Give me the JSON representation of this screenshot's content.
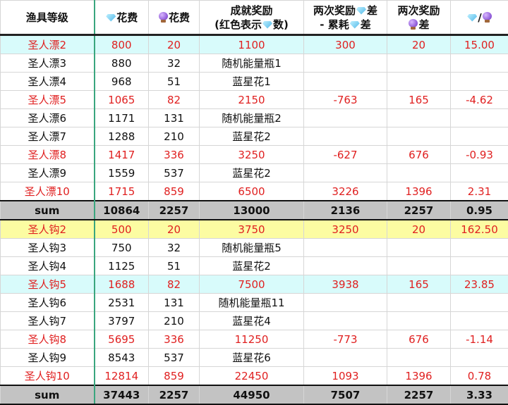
{
  "header": {
    "level": "渔具等级",
    "diamond_cost": "花费",
    "orb_cost": "花费",
    "reward_line1": "成就奖励",
    "reward_line2a": "(红色表示",
    "reward_line2b": "数)",
    "diff_line1a": "两次奖励",
    "diff_line1b": "差",
    "diff_line2a": "- 累耗",
    "diff_line2b": "差",
    "orbdiff_line1": "两次奖励",
    "orbdiff_line2": "差",
    "ratio_sep": "/"
  },
  "rows": [
    {
      "style": "red cyan",
      "c": [
        "圣人漂2",
        "800",
        "20",
        "1100",
        "300",
        "20",
        "15.00"
      ]
    },
    {
      "style": "",
      "c": [
        "圣人漂3",
        "880",
        "32",
        "随机能量瓶1",
        "",
        "",
        ""
      ]
    },
    {
      "style": "",
      "c": [
        "圣人漂4",
        "968",
        "51",
        "蓝星花1",
        "",
        "",
        ""
      ]
    },
    {
      "style": "red",
      "c": [
        "圣人漂5",
        "1065",
        "82",
        "2150",
        "-763",
        "165",
        "-4.62"
      ]
    },
    {
      "style": "",
      "c": [
        "圣人漂6",
        "1171",
        "131",
        "随机能量瓶2",
        "",
        "",
        ""
      ]
    },
    {
      "style": "",
      "c": [
        "圣人漂7",
        "1288",
        "210",
        "蓝星花2",
        "",
        "",
        ""
      ]
    },
    {
      "style": "red",
      "c": [
        "圣人漂8",
        "1417",
        "336",
        "3250",
        "-627",
        "676",
        "-0.93"
      ]
    },
    {
      "style": "",
      "c": [
        "圣人漂9",
        "1559",
        "537",
        "蓝星花2",
        "",
        "",
        ""
      ]
    },
    {
      "style": "red",
      "c": [
        "圣人漂10",
        "1715",
        "859",
        "6500",
        "3226",
        "1396",
        "2.31"
      ]
    },
    {
      "style": "sum",
      "c": [
        "sum",
        "10864",
        "2257",
        "13000",
        "2136",
        "2257",
        "0.95"
      ]
    },
    {
      "style": "red yellow",
      "c": [
        "圣人钩2",
        "500",
        "20",
        "3750",
        "3250",
        "20",
        "162.50"
      ]
    },
    {
      "style": "",
      "c": [
        "圣人钩3",
        "750",
        "32",
        "随机能量瓶5",
        "",
        "",
        ""
      ]
    },
    {
      "style": "",
      "c": [
        "圣人钩4",
        "1125",
        "51",
        "蓝星花2",
        "",
        "",
        ""
      ]
    },
    {
      "style": "red cyan",
      "c": [
        "圣人钩5",
        "1688",
        "82",
        "7500",
        "3938",
        "165",
        "23.85"
      ]
    },
    {
      "style": "",
      "c": [
        "圣人钩6",
        "2531",
        "131",
        "随机能量瓶11",
        "",
        "",
        ""
      ]
    },
    {
      "style": "",
      "c": [
        "圣人钩7",
        "3797",
        "210",
        "蓝星花4",
        "",
        "",
        ""
      ]
    },
    {
      "style": "red",
      "c": [
        "圣人钩8",
        "5695",
        "336",
        "11250",
        "-773",
        "676",
        "-1.14"
      ]
    },
    {
      "style": "",
      "c": [
        "圣人钩9",
        "8543",
        "537",
        "蓝星花6",
        "",
        "",
        ""
      ]
    },
    {
      "style": "red",
      "c": [
        "圣人钩10",
        "12814",
        "859",
        "22450",
        "1093",
        "1396",
        "0.78"
      ]
    },
    {
      "style": "sum",
      "c": [
        "sum",
        "37443",
        "2257",
        "44950",
        "7507",
        "2257",
        "3.33"
      ]
    }
  ]
}
